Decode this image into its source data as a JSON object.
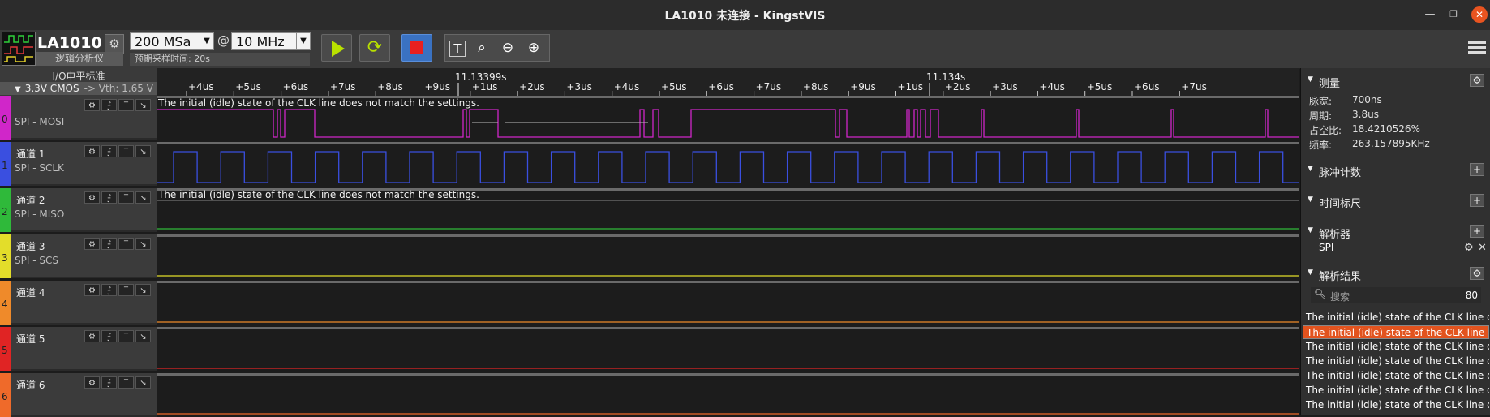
{
  "window": {
    "title": "LA1010 未连接 - KingstVIS"
  },
  "toolbar": {
    "device_name": "LA1010",
    "device_sub": "逻辑分析仪",
    "sample_count": "200 MSa",
    "at": "@",
    "sample_rate": "10 MHz",
    "expected_time": "预期采样时间: 20s"
  },
  "io": {
    "standard_label": "I/O电平标准",
    "level": "3.3V CMOS",
    "vth": "-> Vth: 1.65 V"
  },
  "channels": [
    {
      "num": "0",
      "name": "",
      "sub": "SPI - MOSI",
      "color": "#d026c9"
    },
    {
      "num": "1",
      "name": "通道 1",
      "sub": "SPI - SCLK",
      "color": "#3a4fe0"
    },
    {
      "num": "2",
      "name": "通道 2",
      "sub": "SPI - MISO",
      "color": "#2fb93a"
    },
    {
      "num": "3",
      "name": "通道 3",
      "sub": "SPI - SCS",
      "color": "#e3dd2a"
    },
    {
      "num": "4",
      "name": "通道 4",
      "sub": "",
      "color": "#ef8a2a"
    },
    {
      "num": "5",
      "name": "通道 5",
      "sub": "",
      "color": "#e02424"
    },
    {
      "num": "6",
      "name": "通道 6",
      "sub": "",
      "color": "#ef6a2a"
    }
  ],
  "timeline": {
    "ticks": [
      "+4us",
      "+5us",
      "+6us",
      "+7us",
      "+8us",
      "+9us",
      "+1us",
      "+2us",
      "+3us",
      "+4us",
      "+5us",
      "+6us",
      "+7us",
      "+8us",
      "+9us",
      "+1us",
      "+2us",
      "+3us",
      "+4us",
      "+5us",
      "+6us",
      "+7us"
    ],
    "markers": [
      "11.13399s",
      "11.134s"
    ]
  },
  "waveform": {
    "warning_ch0": "The initial (idle) state of the CLK line does not match the settings.",
    "warning_ch2": "The initial (idle) state of the CLK line does not match the settings."
  },
  "panel": {
    "measure": {
      "title": "测量",
      "rows": [
        {
          "label": "脉宽:",
          "value": "700ns"
        },
        {
          "label": "周期:",
          "value": "3.8us"
        },
        {
          "label": "占空比:",
          "value": "18.4210526%"
        },
        {
          "label": "频率:",
          "value": "263.157895KHz"
        }
      ]
    },
    "pulse_count": "脉冲计数",
    "time_ruler": "时间标尺",
    "decoder": {
      "title": "解析器",
      "item": "SPI"
    },
    "decode_results": {
      "title": "解析结果",
      "search_placeholder": "搜索",
      "count": "80",
      "items": [
        "The initial (idle) state of the CLK line do...",
        "The initial (idle) state of the CLK line do...",
        "The initial (idle) state of the CLK line do...",
        "The initial (idle) state of the CLK line do...",
        "The initial (idle) state of the CLK line do...",
        "The initial (idle) state of the CLK line do...",
        "The initial (idle) state of the CLK line do..."
      ]
    }
  }
}
